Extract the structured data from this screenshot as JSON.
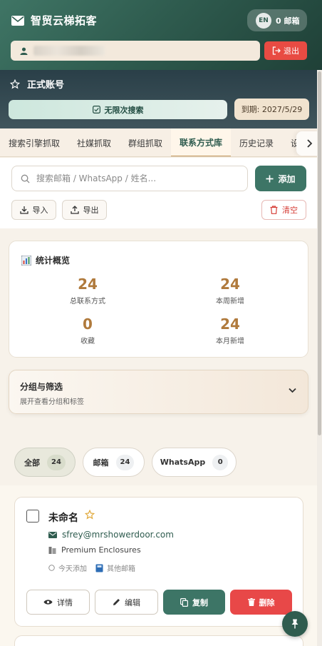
{
  "header": {
    "app_title": "智贸云梯拓客",
    "lang_badge": "EN",
    "mailbox_count_label": "0 邮箱",
    "logout_label": "退出"
  },
  "account": {
    "title": "正式账号",
    "unlimited_search_label": "无限次搜索",
    "expiry_label": "到期: 2027/5/29"
  },
  "tabs": [
    {
      "label": "搜索引擎抓取"
    },
    {
      "label": "社媒抓取"
    },
    {
      "label": "群组抓取"
    },
    {
      "label": "联系方式库",
      "active": true
    },
    {
      "label": "历史记录"
    },
    {
      "label": "设"
    }
  ],
  "toolbar": {
    "search_placeholder": "搜索邮箱 / WhatsApp / 姓名...",
    "add_label": "添加",
    "import_label": "导入",
    "export_label": "导出",
    "clear_label": "清空"
  },
  "stats": {
    "title": "统计概览",
    "items": [
      {
        "value": "24",
        "label": "总联系方式"
      },
      {
        "value": "24",
        "label": "本周新增"
      },
      {
        "value": "0",
        "label": "收藏"
      },
      {
        "value": "24",
        "label": "本月新增"
      }
    ]
  },
  "filter": {
    "title": "分组与筛选",
    "subtitle": "展开查看分组和标签"
  },
  "pills": [
    {
      "label": "全部",
      "count": "24",
      "active": true
    },
    {
      "label": "邮箱",
      "count": "24"
    },
    {
      "label": "WhatsApp",
      "count": "0"
    }
  ],
  "contact": {
    "name": "未命名",
    "email": "sfrey@mrshowerdoor.com",
    "company": "Premium Enclosures",
    "added": "今天添加",
    "source": "其他邮箱",
    "details_label": "详情",
    "edit_label": "编辑",
    "copy_label": "复制",
    "delete_label": "删除"
  },
  "colors": {
    "brand_green": "#3d7566",
    "accent_gold": "#b07a3c",
    "danger_red": "#e84848"
  }
}
